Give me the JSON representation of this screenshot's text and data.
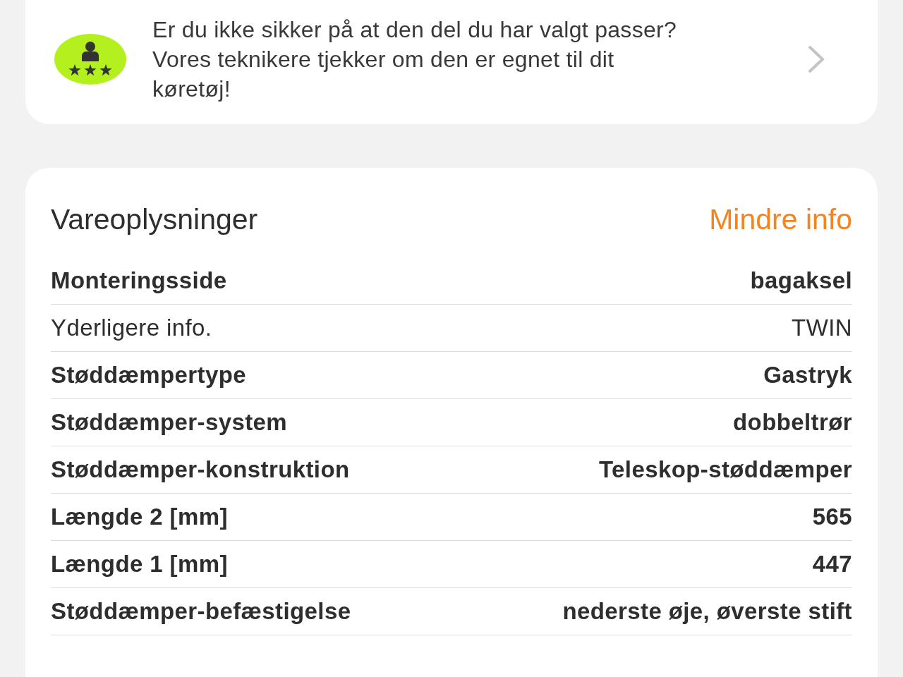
{
  "banner": {
    "message_lines": [
      "Er du ikke sikker på at den del du har valgt passer?",
      "Vores teknikere tjekker om den er egnet  til dit",
      "køretøj!"
    ]
  },
  "product_info": {
    "title": "Vareoplysninger",
    "toggle_link": "Mindre info",
    "rows": [
      {
        "label": "Monteringsside",
        "value": "bagaksel",
        "kind": "bold"
      },
      {
        "label": "Yderligere info.",
        "value": "TWIN",
        "kind": "plain"
      },
      {
        "label": "Støddæmpertype",
        "value": "Gastryk",
        "kind": "bold"
      },
      {
        "label": "Støddæmper-system",
        "value": "dobbeltrør",
        "kind": "bold"
      },
      {
        "label": "Støddæmper-konstruktion",
        "value": "Teleskop-støddæmper",
        "kind": "bold"
      },
      {
        "label": "Længde 2 [mm]",
        "value": "565",
        "kind": "bold"
      },
      {
        "label": "Længde 1 [mm]",
        "value": "447",
        "kind": "bold"
      },
      {
        "label": "Støddæmper-befæstigelse",
        "value": "nederste øje, øverste stift",
        "kind": "bold"
      }
    ]
  }
}
